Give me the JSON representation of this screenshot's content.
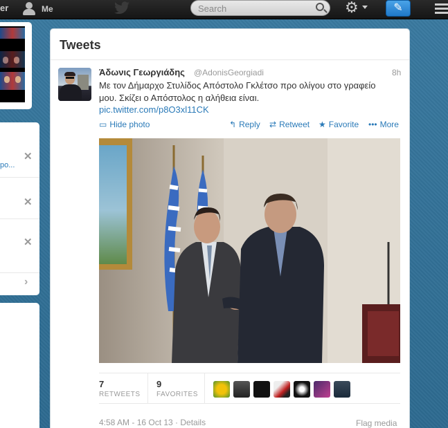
{
  "topbar": {
    "left_fragment": "er",
    "me_label": "Me",
    "search_placeholder": "Search"
  },
  "left_panel": {
    "link_fragment": "po..."
  },
  "timeline": {
    "title": "Tweets"
  },
  "tweet": {
    "author_name": "Άδωνις Γεωργιάδης",
    "handle": "@AdonisGeorgiadi",
    "time": "8h",
    "text": "Με τον Δήμαρχο Στυλίδος Απόστολο Γκλέτσο προ ολίγου στο γραφείο μου. Σκίζει ο Απόστολος η αλήθεια είναι.",
    "link": "pic.twitter.com/p8O3xl11CK",
    "actions": {
      "hide_photo": "Hide photo",
      "reply": "Reply",
      "retweet": "Retweet",
      "favorite": "Favorite",
      "more": "More"
    },
    "stats": {
      "retweets_count": "7",
      "retweets_label": "RETWEETS",
      "favorites_count": "9",
      "favorites_label": "FAVORITES"
    },
    "meta": "4:58 AM - 16 Oct 13 · Details",
    "flag_media": "Flag media"
  },
  "colors": {
    "link_blue": "#2a7ab8",
    "background": "#2f6f94",
    "topbar": "#1a1a1a",
    "compose": "#2a8ee0"
  }
}
